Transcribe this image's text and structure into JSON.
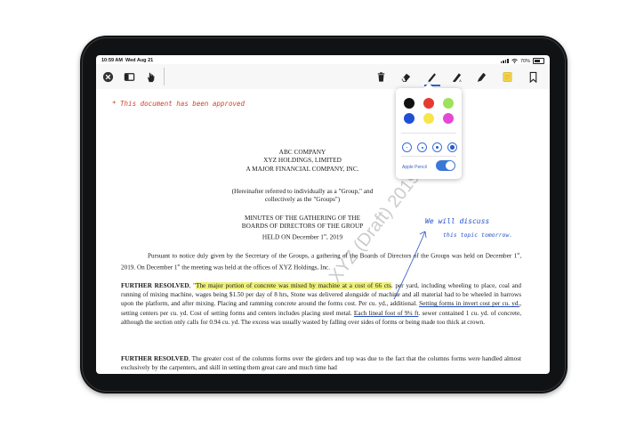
{
  "status": {
    "time": "10:59 AM",
    "date": "Wed Aug 21",
    "battery": "70%"
  },
  "doc": {
    "note_approved": "* This document has been approved",
    "note_discuss_1": "We will discuss",
    "note_discuss_2": "this topic tomorrow.",
    "header": {
      "line1": "ABC COMPANY",
      "line2": "XYZ HOLDINGS, LIMITED",
      "line3": "A MAJOR FINANCIAL COMPANY, INC."
    },
    "referred": {
      "line1": "(Hereinafter referred to individually as a \"Group,\" and",
      "line2": "collectively as the \"Groups\")"
    },
    "minutes": {
      "line1": "MINUTES OF THE GATHERING OF THE",
      "line2": "BOARDS OF DIRECTORS OF THE GROUP",
      "line3_pre": "HELD ON December 1",
      "line3_sup": "st",
      "line3_post": ", 2019"
    },
    "para1": {
      "p1": "Pursuant to notice duly given by the Secretary of the Groups, a gathering of the Boards of Directors of the Groups was held on December 1",
      "sup1": "st",
      "p2": ", 2019. On December 1",
      "sup2": "st",
      "p3": " the meeting was held at the offices of XYZ Holdings, Inc."
    },
    "para2": {
      "bold": "FURTHER RESOLVED",
      "t1": ", \"",
      "highlight": "The major portion of concrete was mixed by machine at a cost of 66 cts",
      "t2": ". per yard, including wheeling to place, coal and running of mixing machine, wages being $1.50 per day of 8 hrs, Stone was delivered alongside of machine and all material had to be wheeled in barrows upon the platform, and after mixing. Placing and ramming concrete around the forms cost. Per cu. yd., additional. ",
      "u1": "Setting forms in invert cost per cu. yd.",
      "t3": ", setting centers per cu. yd. Cost of setting forms and centers includes placing steel metal. ",
      "u2": "Each lineal foot of 9¼ ft",
      "t4": ". sewer contained 1 cu. yd. of concrete, although the section only calls for 0.94 cu. yd. The excess was usually wasted by falling over sides of forms or being made too thick at crown."
    },
    "para3": {
      "bold": "FURTHER RESOLVED",
      "text": ", The greater cost of the columns forms over the girders and top was due to the fact that the columns forms were handled almost exclusively by the carpenters, and skill in setting them great care and much time had"
    },
    "watermark": "XYZ (Draft) 2019"
  },
  "popover": {
    "colors": [
      "#111111",
      "#e53a2f",
      "#9ee25a",
      "#1e50d6",
      "#f7e64a",
      "#e548d6"
    ],
    "pencil_label": "Apple Pencil"
  },
  "toolbar": {
    "icons": [
      "close-icon",
      "sidebar-icon",
      "hand-icon",
      "trash-icon",
      "eraser-icon",
      "pen-icon",
      "highlighter-pen-icon",
      "marker-icon",
      "sticky-note-icon",
      "bookmark-icon"
    ],
    "accent": "#2a63d8"
  }
}
